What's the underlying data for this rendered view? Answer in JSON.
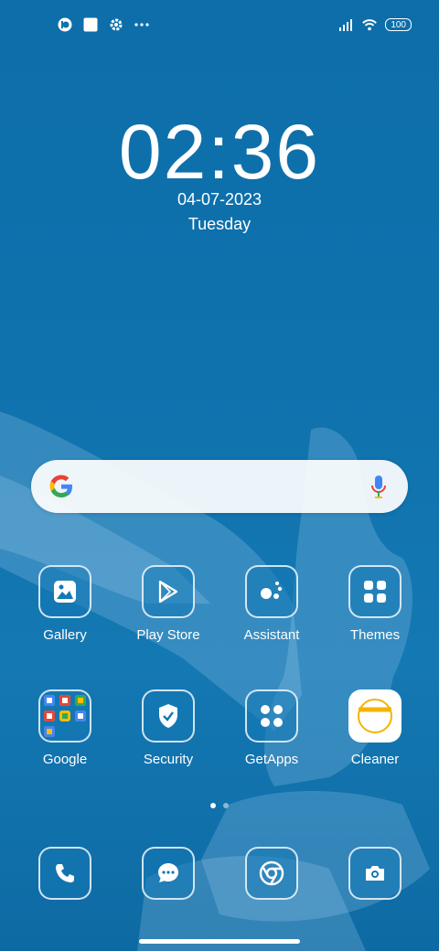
{
  "status_bar": {
    "battery": "100",
    "left_icons": [
      "notification-app-icon",
      "square-icon",
      "gear-icon",
      "more-dots-icon"
    ],
    "right_icons": [
      "signal-icon",
      "wifi-icon",
      "battery-icon"
    ]
  },
  "lockscreen": {
    "time": "02:36",
    "date": "04-07-2023",
    "day": "Tuesday"
  },
  "search": {
    "logo": "google-icon",
    "mic": "mic-icon"
  },
  "apps_row1": [
    {
      "label": "Gallery",
      "icon": "gallery-icon"
    },
    {
      "label": "Play Store",
      "icon": "play-store-icon"
    },
    {
      "label": "Assistant",
      "icon": "assistant-icon"
    },
    {
      "label": "Themes",
      "icon": "themes-icon"
    }
  ],
  "apps_row2": [
    {
      "label": "Google",
      "icon": "folder-icon"
    },
    {
      "label": "Security",
      "icon": "shield-icon"
    },
    {
      "label": "GetApps",
      "icon": "getapps-icon"
    },
    {
      "label": "Cleaner",
      "icon": "cleaner-icon"
    }
  ],
  "dock": [
    {
      "icon": "phone-icon"
    },
    {
      "icon": "messages-icon"
    },
    {
      "icon": "chrome-icon"
    },
    {
      "icon": "camera-icon"
    }
  ],
  "colors": {
    "wallpaper": "#0f72ad",
    "accent": "#ffffff"
  }
}
